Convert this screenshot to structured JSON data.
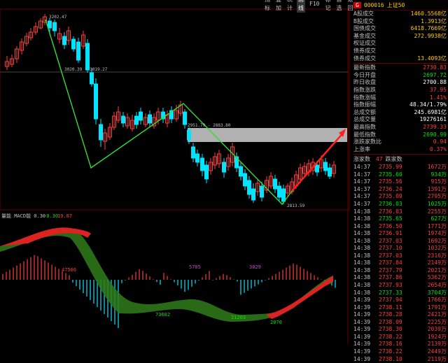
{
  "toolbar": {
    "buttons": [
      "指标",
      "叠加",
      "统计",
      "画线",
      "F10",
      "标记",
      "自选",
      "返回"
    ],
    "active_index": 3
  },
  "kline": {
    "annotations": {
      "peak": "3202.47",
      "level1": "3020.39 - 3019.27",
      "level2": "2951.79 - 2883.80",
      "trough": "2813.59"
    },
    "price_axis": [
      "3200",
      "3150",
      "3100",
      "3050",
      "3000",
      "2950",
      "2900",
      "2850",
      "2800"
    ]
  },
  "indicator": {
    "title": "量能",
    "subtitle": "MACD能 0.30",
    "v1": "-0.30",
    "v2": "19.87",
    "labels": [
      "47506",
      "5705",
      "3029",
      "73682",
      "21203",
      "2070"
    ],
    "axis": [
      "40.00",
      "30.00",
      "20.00",
      "10.00",
      "0.00",
      "-10.00",
      "-20.00",
      "-30.00",
      "-40.00"
    ]
  },
  "quote": {
    "badge": "G",
    "code": "000016",
    "name": "上证50",
    "top_stats": [
      {
        "k": "A股成交",
        "v": "1460.5568亿"
      },
      {
        "k": "B股成交",
        "v": "1.3913亿"
      },
      {
        "k": "国债成交",
        "v": "6418.7669亿"
      },
      {
        "k": "基金成交",
        "v": "272.9938亿"
      },
      {
        "k": "权证成交",
        "v": ""
      },
      {
        "k": "债券成交",
        "v": ""
      },
      {
        "k": "债券成交",
        "v": "13.4093亿"
      }
    ],
    "stats": [
      {
        "k": "最新指数",
        "v": "2730.83",
        "c": "red"
      },
      {
        "k": "今日开盘",
        "v": "2697.72",
        "c": "green"
      },
      {
        "k": "昨日收盘",
        "v": "2700.88",
        "c": "white"
      },
      {
        "k": "指数涨跌",
        "v": "37.95",
        "c": "red"
      },
      {
        "k": "指数涨幅",
        "v": "1.41%",
        "c": "red"
      },
      {
        "k": "指数振幅",
        "v": "48.34/1.79%",
        "c": "white"
      },
      {
        "k": "总成交额",
        "v": "245.6981亿",
        "c": "white"
      },
      {
        "k": "总成交量",
        "v": "19276161",
        "c": "white"
      },
      {
        "k": "最高指数",
        "v": "2739.33",
        "c": "red"
      },
      {
        "k": "最低指数",
        "v": "2690.99",
        "c": "green"
      },
      {
        "k": "涨跌家数比",
        "v": "0.94",
        "c": "red"
      },
      {
        "k": "上涨率",
        "v": "0.37%",
        "c": "red"
      }
    ],
    "tick_header": {
      "a": "涨家数",
      "b": "47",
      "c": "跌家数"
    },
    "ticks": [
      {
        "t": "14:37",
        "p": "2735.99",
        "q": "1672万",
        "g": false
      },
      {
        "t": "14:37",
        "p": "2735.60",
        "q": "934万",
        "g": true
      },
      {
        "t": "14:37",
        "p": "2735.56",
        "q": "915万",
        "g": false
      },
      {
        "t": "14:37",
        "p": "2736.24",
        "q": "1391万",
        "g": false
      },
      {
        "t": "14:37",
        "p": "2735.09",
        "q": "2795万",
        "g": false
      },
      {
        "t": "14:37",
        "p": "2736.03",
        "q": "1025万",
        "g": true
      },
      {
        "t": "14:38",
        "p": "2736.03",
        "q": "2255万",
        "g": false
      },
      {
        "t": "14:38",
        "p": "2735.65",
        "q": "627万",
        "g": true
      },
      {
        "t": "14:38",
        "p": "2736.50",
        "q": "1771万",
        "g": false
      },
      {
        "t": "14:38",
        "p": "2736.91",
        "q": "1974万",
        "g": false
      },
      {
        "t": "14:38",
        "p": "2737.03",
        "q": "1692万",
        "g": false
      },
      {
        "t": "14:38",
        "p": "2737.10",
        "q": "1032万",
        "g": false
      },
      {
        "t": "14:38",
        "p": "2737.03",
        "q": "2316万",
        "g": false
      },
      {
        "t": "14:38",
        "p": "2737.84",
        "q": "2149万",
        "g": false
      },
      {
        "t": "14:38",
        "p": "2737.79",
        "q": "2021万",
        "g": false
      },
      {
        "t": "14:38",
        "p": "2737.86",
        "q": "5362万",
        "g": false
      },
      {
        "t": "14:38",
        "p": "2737.93",
        "q": "2654万",
        "g": false
      },
      {
        "t": "14:38",
        "p": "2737.33",
        "q": "3704万",
        "g": true
      },
      {
        "t": "14:39",
        "p": "2737.94",
        "q": "1766万",
        "g": false
      },
      {
        "t": "14:39",
        "p": "2738.11",
        "q": "1791万",
        "g": false
      },
      {
        "t": "14:39",
        "p": "2738.28",
        "q": "2421万",
        "g": false
      },
      {
        "t": "14:39",
        "p": "2738.09",
        "q": "2225万",
        "g": false
      },
      {
        "t": "14:39",
        "p": "2738.30",
        "q": "2039万",
        "g": false
      },
      {
        "t": "14:39",
        "p": "2738.22",
        "q": "1924万",
        "g": false
      },
      {
        "t": "14:39",
        "p": "2738.16",
        "q": "2139万",
        "g": false
      },
      {
        "t": "14:39",
        "p": "2738.22",
        "q": "2449万",
        "g": false
      },
      {
        "t": "14:39",
        "p": "2738.10",
        "q": "2119万",
        "g": false
      }
    ]
  },
  "colors": {
    "up": "#ff3c3c",
    "down": "#00e5ff",
    "zig": "#33dd33",
    "accent": "#ffcc00"
  }
}
